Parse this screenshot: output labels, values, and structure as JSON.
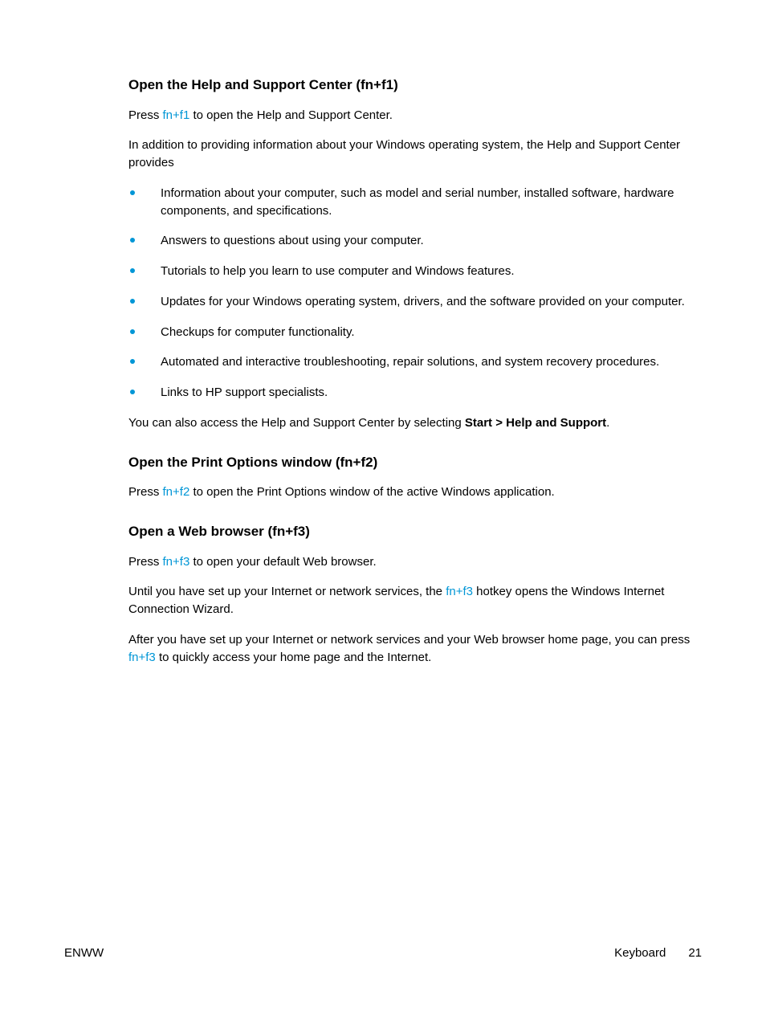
{
  "section1": {
    "heading": "Open the Help and Support Center (fn+f1)",
    "p1_a": "Press ",
    "p1_key": "fn+f1",
    "p1_b": " to open the Help and Support Center.",
    "p2": "In addition to providing information about your Windows operating system, the Help and Support Center provides",
    "bullets": [
      "Information about your computer, such as model and serial number, installed software, hardware components, and specifications.",
      "Answers to questions about using your computer.",
      "Tutorials to help you learn to use computer and Windows features.",
      "Updates for your Windows operating system, drivers, and the software provided on your computer.",
      "Checkups for computer functionality.",
      "Automated and interactive troubleshooting, repair solutions, and system recovery procedures.",
      "Links to HP support specialists."
    ],
    "p3_a": "You can also access the Help and Support Center by selecting ",
    "p3_bold": "Start > Help and Support",
    "p3_b": "."
  },
  "section2": {
    "heading": "Open the Print Options window (fn+f2)",
    "p1_a": "Press ",
    "p1_key": "fn+f2",
    "p1_b": " to open the Print Options window of the active Windows application."
  },
  "section3": {
    "heading": "Open a Web browser (fn+f3)",
    "p1_a": "Press ",
    "p1_key": "fn+f3",
    "p1_b": " to open your default Web browser.",
    "p2_a": "Until you have set up your Internet or network services, the ",
    "p2_key": "fn+f3",
    "p2_b": " hotkey opens the Windows Internet Connection Wizard.",
    "p3_a": "After you have set up your Internet or network services and your Web browser home page, you can press ",
    "p3_key": "fn+f3",
    "p3_b": " to quickly access your home page and the Internet."
  },
  "footer": {
    "left": "ENWW",
    "section": "Keyboard",
    "page": "21"
  }
}
